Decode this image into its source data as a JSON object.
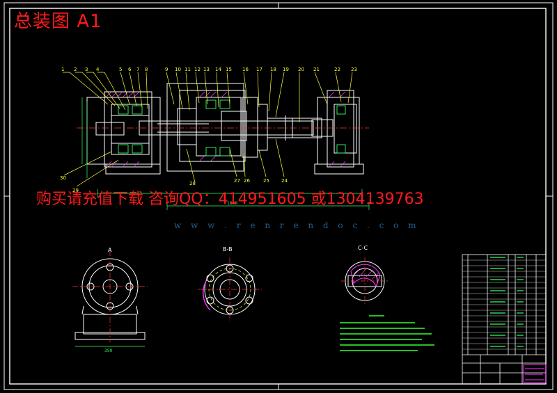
{
  "title": "总装图 A1",
  "promo_text": "购买请充值下载 咨询QQ：414951605 或1304139763",
  "watermark_url": "w w w . r e n r e n d o c . c o m",
  "view_labels": {
    "a": "A",
    "bb": "B-B",
    "cc": "C-C"
  },
  "part_callouts_top": [
    "1",
    "2",
    "3",
    "4",
    "5",
    "6",
    "7",
    "8",
    "9",
    "10",
    "11",
    "12",
    "13",
    "14",
    "15",
    "16",
    "17",
    "18",
    "19",
    "20",
    "21",
    "22",
    "23"
  ],
  "part_callouts_bottom": [
    "30",
    "29",
    "28",
    "27",
    "26",
    "25",
    "24"
  ],
  "dimension_texts": {
    "overall_length": "1990",
    "base_width": "350"
  },
  "colors": {
    "background": "#000000",
    "frame": "#ffffff",
    "part_lines": "#ffffff",
    "callout": "#ffff33",
    "dimension": "#33ff66",
    "centerline": "#ff3333",
    "section_hatch": "#ff33ff",
    "notes": "#33ff33",
    "overlay_red": "#ff1a1a",
    "watermark": "#2f7fbf"
  }
}
